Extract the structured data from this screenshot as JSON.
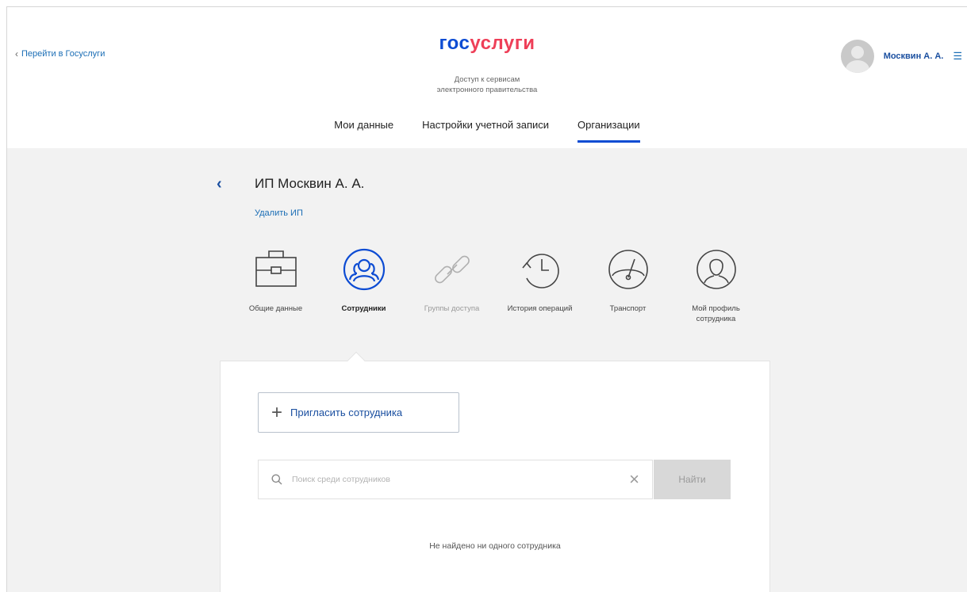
{
  "header": {
    "back_link": "Перейти в Госуслуги",
    "logo_part1": "гос",
    "logo_part2": "услуги",
    "tagline_line1": "Доступ к сервисам",
    "tagline_line2": "электронного правительства",
    "user_name": "Москвин А. А."
  },
  "nav": {
    "tabs": [
      {
        "label": "Мои данные",
        "active": false
      },
      {
        "label": "Настройки учетной записи",
        "active": false
      },
      {
        "label": "Организации",
        "active": true
      }
    ]
  },
  "org": {
    "title": "ИП Москвин А. А.",
    "delete_link": "Удалить ИП"
  },
  "sections": [
    {
      "label": "Общие данные",
      "icon": "briefcase-icon",
      "state": "normal"
    },
    {
      "label": "Сотрудники",
      "icon": "employees-icon",
      "state": "active"
    },
    {
      "label": "Группы доступа",
      "icon": "chain-link-icon",
      "state": "disabled"
    },
    {
      "label": "История операций",
      "icon": "history-clock-icon",
      "state": "normal"
    },
    {
      "label": "Транспорт",
      "icon": "speedometer-icon",
      "state": "normal"
    },
    {
      "label": "Мой профиль сотрудника",
      "icon": "profile-icon",
      "state": "normal"
    }
  ],
  "panel": {
    "invite_button": "Пригласить сотрудника",
    "search_placeholder": "Поиск среди сотрудников",
    "search_value": "",
    "find_button": "Найти",
    "empty_message": "Не найдено ни одного сотрудника"
  },
  "colors": {
    "brand_blue": "#0d4cd3",
    "brand_red": "#ee3f58",
    "link_blue": "#1a6db5",
    "background": "#f2f2f2"
  }
}
